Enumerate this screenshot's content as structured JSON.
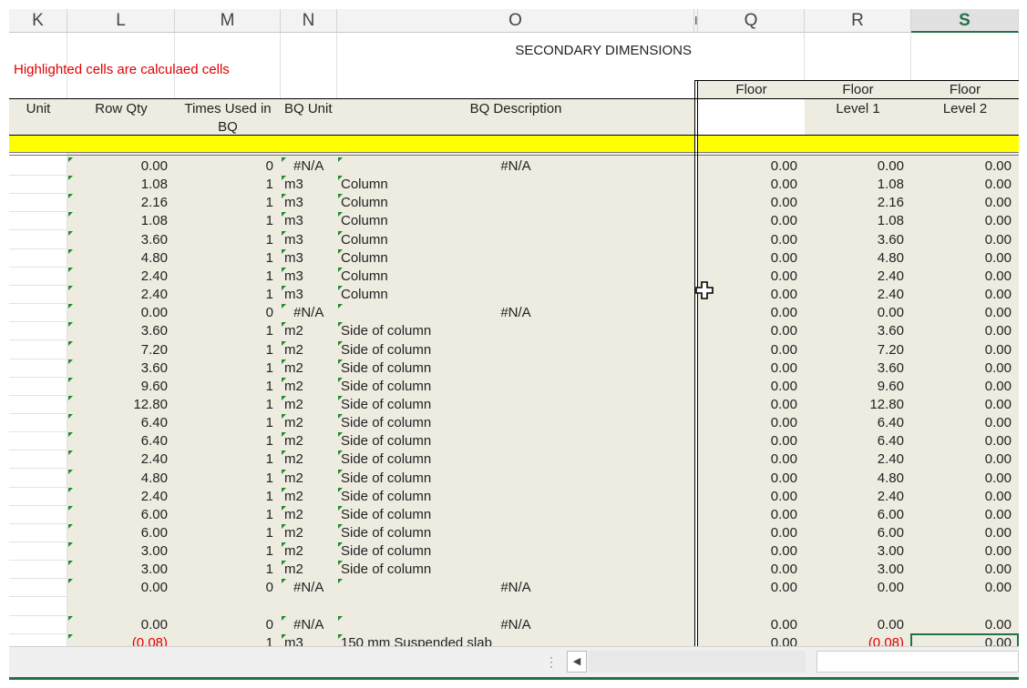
{
  "columns": [
    "K",
    "L",
    "M",
    "N",
    "O",
    "I",
    "Q",
    "R",
    "S"
  ],
  "title": "SECONDARY DIMENSIONS",
  "note": "Highlighted cells are calculaed cells",
  "headers": {
    "unit": "Unit",
    "row_qty": "Row Qty",
    "times_used_1": "Times Used in",
    "times_used_2": "BQ",
    "bq_unit": "BQ Unit",
    "bq_desc": "BQ Description",
    "q_floor": "Floor",
    "r_floor": "Floor",
    "r_level": "Level 1",
    "s_floor": "Floor",
    "s_level": "Level 2"
  },
  "rows": [
    {
      "qty": "0.00",
      "times": "0",
      "unit": "#N/A",
      "desc": "#N/A",
      "q": "0.00",
      "r": "0.00",
      "s": "0.00"
    },
    {
      "qty": "1.08",
      "times": "1",
      "unit": "m3",
      "desc": "Column",
      "q": "0.00",
      "r": "1.08",
      "s": "0.00"
    },
    {
      "qty": "2.16",
      "times": "1",
      "unit": "m3",
      "desc": "Column",
      "q": "0.00",
      "r": "2.16",
      "s": "0.00"
    },
    {
      "qty": "1.08",
      "times": "1",
      "unit": "m3",
      "desc": "Column",
      "q": "0.00",
      "r": "1.08",
      "s": "0.00"
    },
    {
      "qty": "3.60",
      "times": "1",
      "unit": "m3",
      "desc": "Column",
      "q": "0.00",
      "r": "3.60",
      "s": "0.00"
    },
    {
      "qty": "4.80",
      "times": "1",
      "unit": "m3",
      "desc": "Column",
      "q": "0.00",
      "r": "4.80",
      "s": "0.00"
    },
    {
      "qty": "2.40",
      "times": "1",
      "unit": "m3",
      "desc": "Column",
      "q": "0.00",
      "r": "2.40",
      "s": "0.00"
    },
    {
      "qty": "2.40",
      "times": "1",
      "unit": "m3",
      "desc": "Column",
      "q": "0.00",
      "r": "2.40",
      "s": "0.00"
    },
    {
      "qty": "0.00",
      "times": "0",
      "unit": "#N/A",
      "desc": "#N/A",
      "q": "0.00",
      "r": "0.00",
      "s": "0.00"
    },
    {
      "qty": "3.60",
      "times": "1",
      "unit": "m2",
      "desc": "Side of column",
      "q": "0.00",
      "r": "3.60",
      "s": "0.00"
    },
    {
      "qty": "7.20",
      "times": "1",
      "unit": "m2",
      "desc": "Side of column",
      "q": "0.00",
      "r": "7.20",
      "s": "0.00"
    },
    {
      "qty": "3.60",
      "times": "1",
      "unit": "m2",
      "desc": "Side of column",
      "q": "0.00",
      "r": "3.60",
      "s": "0.00"
    },
    {
      "qty": "9.60",
      "times": "1",
      "unit": "m2",
      "desc": "Side of column",
      "q": "0.00",
      "r": "9.60",
      "s": "0.00"
    },
    {
      "qty": "12.80",
      "times": "1",
      "unit": "m2",
      "desc": "Side of column",
      "q": "0.00",
      "r": "12.80",
      "s": "0.00"
    },
    {
      "qty": "6.40",
      "times": "1",
      "unit": "m2",
      "desc": "Side of column",
      "q": "0.00",
      "r": "6.40",
      "s": "0.00"
    },
    {
      "qty": "6.40",
      "times": "1",
      "unit": "m2",
      "desc": "Side of column",
      "q": "0.00",
      "r": "6.40",
      "s": "0.00"
    },
    {
      "qty": "2.40",
      "times": "1",
      "unit": "m2",
      "desc": "Side of column",
      "q": "0.00",
      "r": "2.40",
      "s": "0.00"
    },
    {
      "qty": "4.80",
      "times": "1",
      "unit": "m2",
      "desc": "Side of column",
      "q": "0.00",
      "r": "4.80",
      "s": "0.00"
    },
    {
      "qty": "2.40",
      "times": "1",
      "unit": "m2",
      "desc": "Side of column",
      "q": "0.00",
      "r": "2.40",
      "s": "0.00"
    },
    {
      "qty": "6.00",
      "times": "1",
      "unit": "m2",
      "desc": "Side of column",
      "q": "0.00",
      "r": "6.00",
      "s": "0.00"
    },
    {
      "qty": "6.00",
      "times": "1",
      "unit": "m2",
      "desc": "Side of column",
      "q": "0.00",
      "r": "6.00",
      "s": "0.00"
    },
    {
      "qty": "3.00",
      "times": "1",
      "unit": "m2",
      "desc": "Side of column",
      "q": "0.00",
      "r": "3.00",
      "s": "0.00"
    },
    {
      "qty": "3.00",
      "times": "1",
      "unit": "m2",
      "desc": "Side of column",
      "q": "0.00",
      "r": "3.00",
      "s": "0.00"
    },
    {
      "qty": "0.00",
      "times": "0",
      "unit": "#N/A",
      "desc": "#N/A",
      "q": "0.00",
      "r": "0.00",
      "s": "0.00"
    },
    {
      "blank": true
    },
    {
      "qty": "0.00",
      "times": "0",
      "unit": "#N/A",
      "desc": "#N/A",
      "q": "0.00",
      "r": "0.00",
      "s": "0.00"
    },
    {
      "qty": "(0.08)",
      "times": "1",
      "unit": "m3",
      "desc": "150 mm Suspended slab",
      "q": "0.00",
      "r": "(0.08)",
      "s": "0.00",
      "neg": true
    }
  ],
  "colors": {
    "calculated_fill": "#eeebe0",
    "highlight": "#ffff00",
    "error_text": "#e00000",
    "excel_green": "#217346"
  },
  "icons": {
    "cursor": "plus-cursor-icon",
    "scroll_left": "chevron-left-icon",
    "sheet_handle": "vertical-dots-icon"
  }
}
